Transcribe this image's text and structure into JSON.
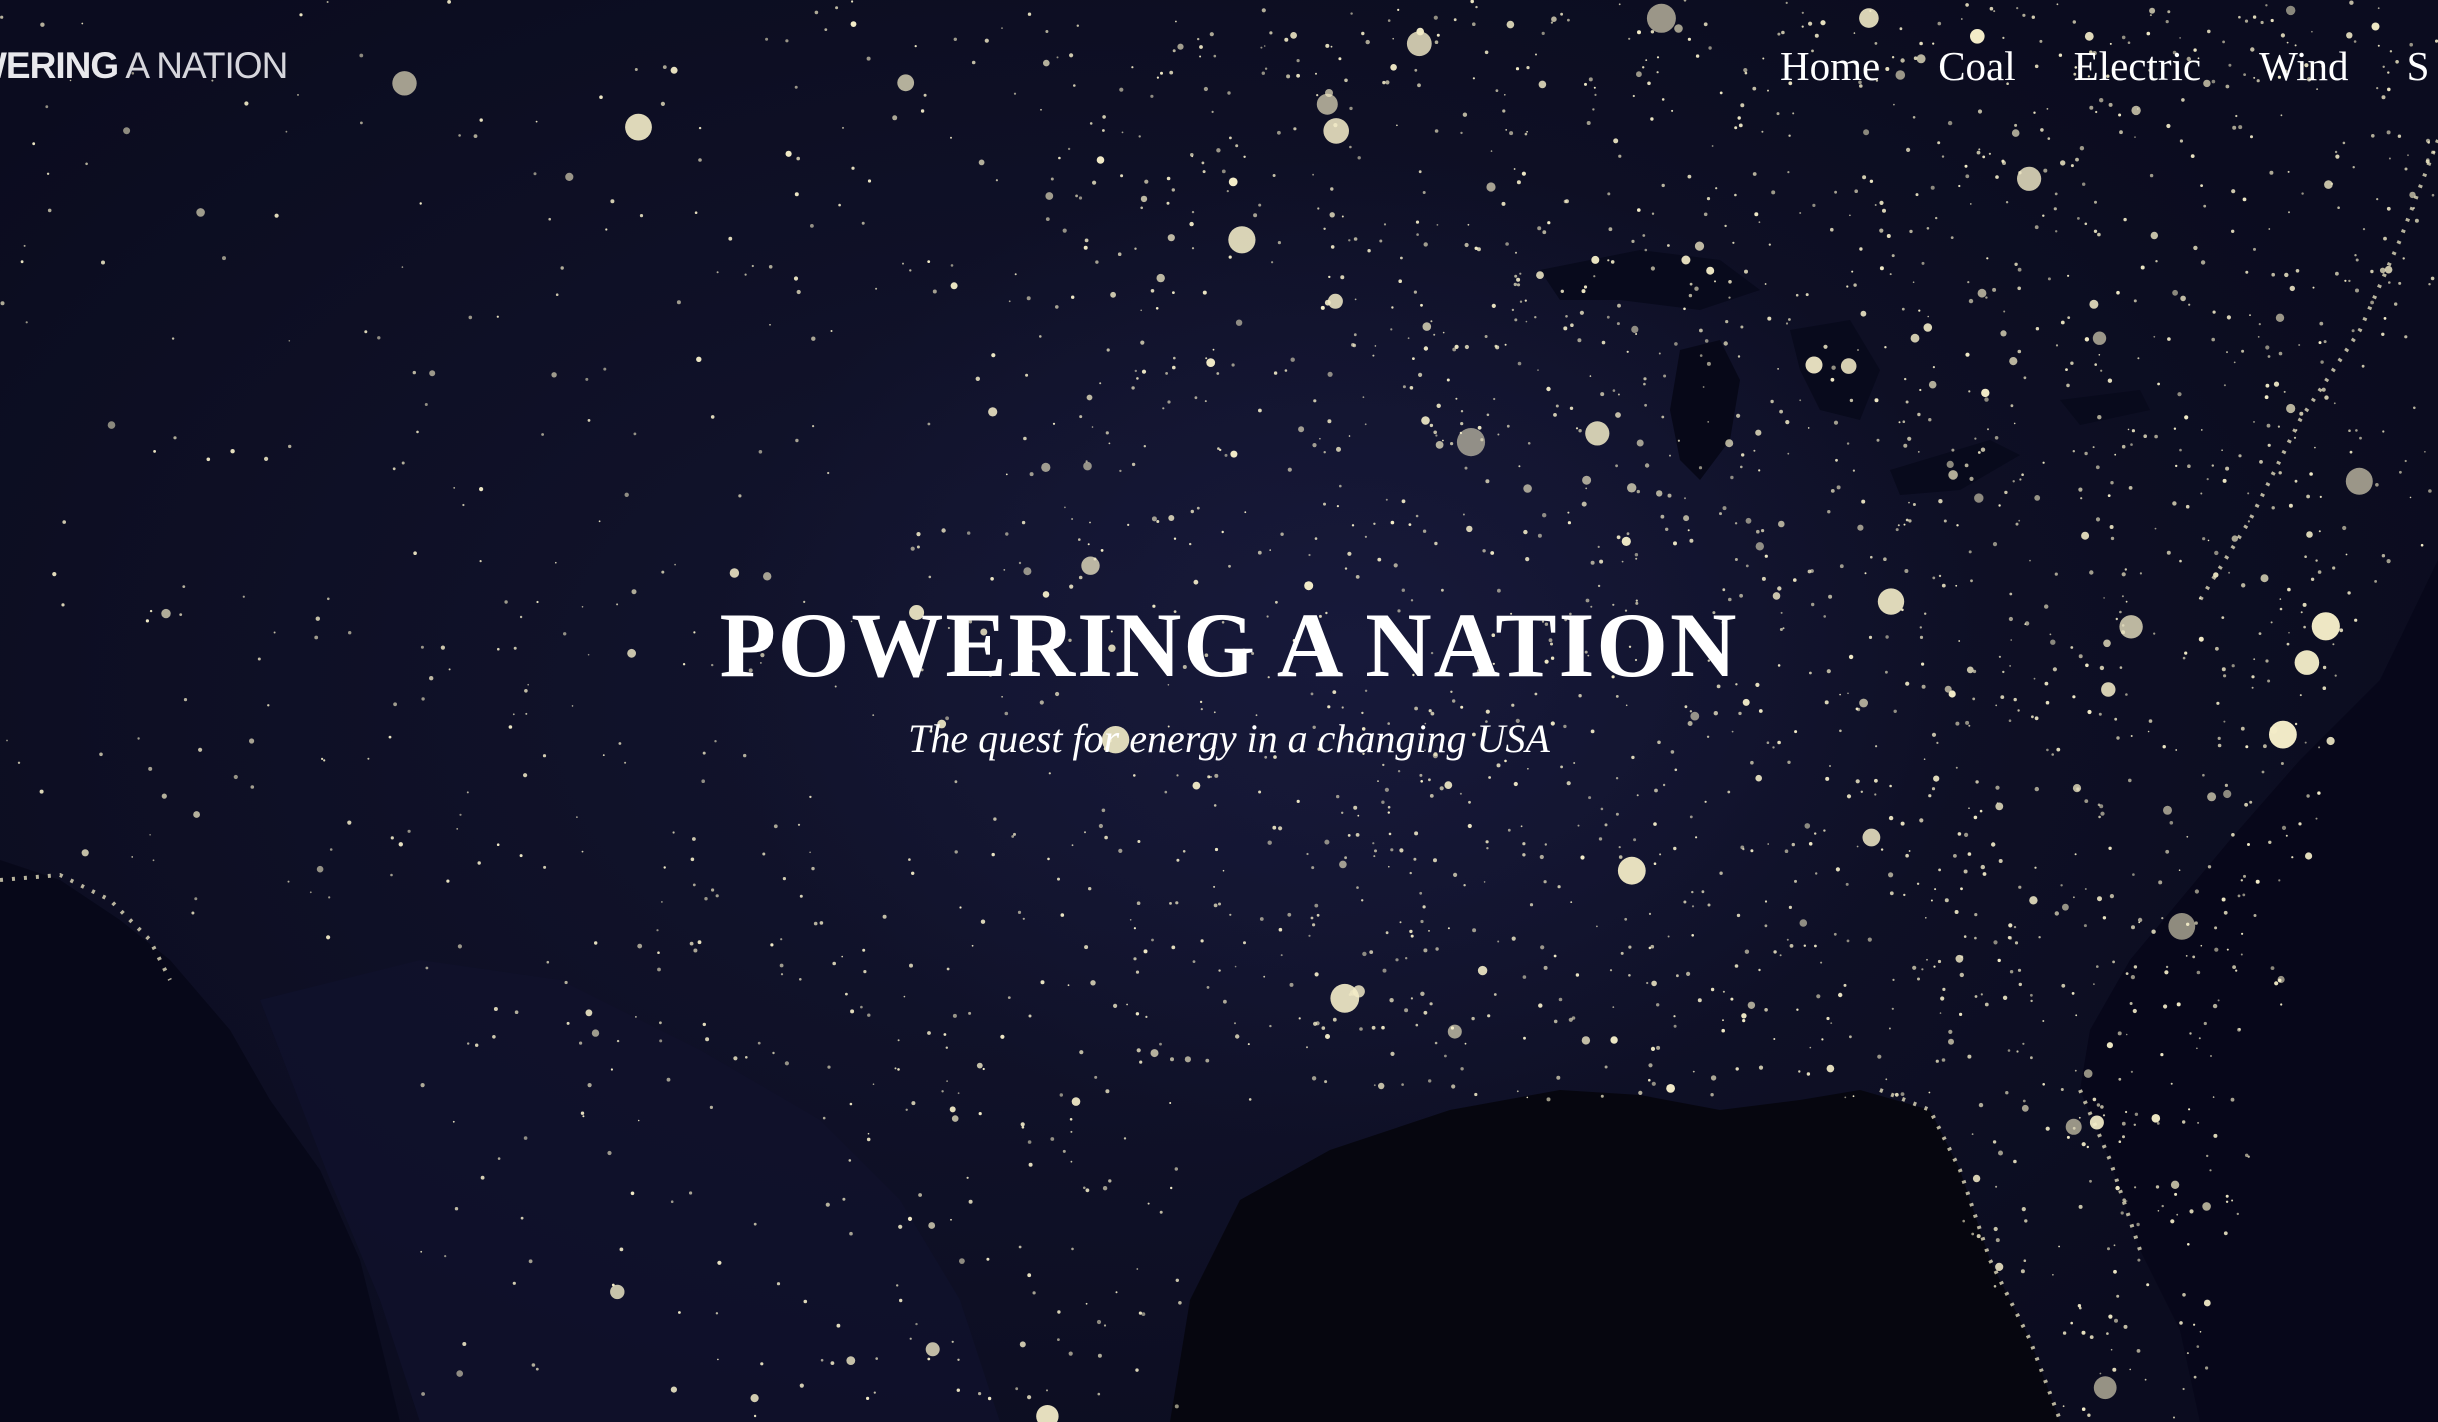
{
  "header": {
    "logo_bold": "WERING",
    "logo_light": " A NATION",
    "nav": [
      {
        "label": "Home"
      },
      {
        "label": "Coal"
      },
      {
        "label": "Electric"
      },
      {
        "label": "Wind"
      },
      {
        "label": "S"
      }
    ]
  },
  "hero": {
    "title": "POWERING A NATION",
    "subtitle": "The quest for energy in a changing USA"
  },
  "colors": {
    "background": "#0a0b1c",
    "land": "#14163a",
    "city_lights": "#f3ecc8",
    "text": "#ffffff"
  }
}
